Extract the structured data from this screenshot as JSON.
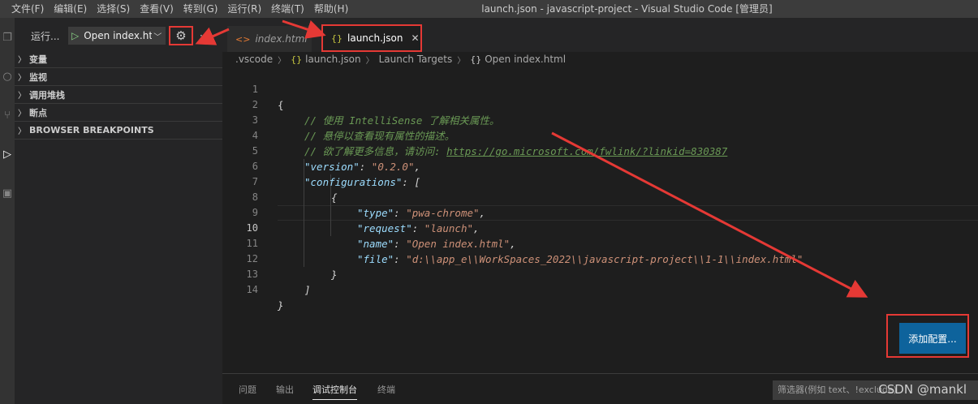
{
  "menu": [
    "文件(F)",
    "编辑(E)",
    "选择(S)",
    "查看(V)",
    "转到(G)",
    "运行(R)",
    "终端(T)",
    "帮助(H)"
  ],
  "window_title": "launch.json - javascript-project - Visual Studio Code [管理员]",
  "sidebar": {
    "run_label": "运行...",
    "config_selected": "Open index.ht",
    "more": "···",
    "sections": [
      "变量",
      "监视",
      "调用堆栈",
      "断点",
      "BROWSER BREAKPOINTS"
    ]
  },
  "tabs": [
    {
      "label": "index.html",
      "icon": "html-icon"
    },
    {
      "label": "launch.json",
      "icon": "json-icon",
      "active": true
    }
  ],
  "breadcrumb": [
    ".vscode",
    "launch.json",
    "Launch Targets",
    "Open index.html"
  ],
  "code": {
    "lines": [
      "1",
      "2",
      "3",
      "4",
      "5",
      "6",
      "7",
      "8",
      "9",
      "10",
      "11",
      "12",
      "13",
      "14"
    ],
    "current_line": "10",
    "l1": "{",
    "l2": "// 使用 IntelliSense 了解相关属性。",
    "l3": "// 悬停以查看现有属性的描述。",
    "l4_prefix": "// 欲了解更多信息，请访问: ",
    "l4_link": "https://go.microsoft.com/fwlink/?linkid=830387",
    "version_key": "\"version\"",
    "version_val": "\"0.2.0\"",
    "configurations_key": "\"configurations\"",
    "type_key": "\"type\"",
    "type_val": "\"pwa-chrome\"",
    "request_key": "\"request\"",
    "request_val": "\"launch\"",
    "name_key": "\"name\"",
    "name_val": "\"Open index.html\"",
    "file_key": "\"file\"",
    "file_val": "\"d:\\\\app_e\\\\WorkSpaces_2022\\\\javascript-project\\\\1-1\\\\index.html\"",
    "l12": "}",
    "l13": "]",
    "l14": "}"
  },
  "add_config_button": "添加配置...",
  "panel": {
    "tabs": [
      "问题",
      "输出",
      "调试控制台",
      "终端"
    ],
    "active": "调试控制台",
    "filter_placeholder": "筛选器(例如 text、!exclude)"
  },
  "watermark": "CSDN @mankl",
  "colors": {
    "accent": "#0e639c",
    "annotation": "#e53935"
  }
}
